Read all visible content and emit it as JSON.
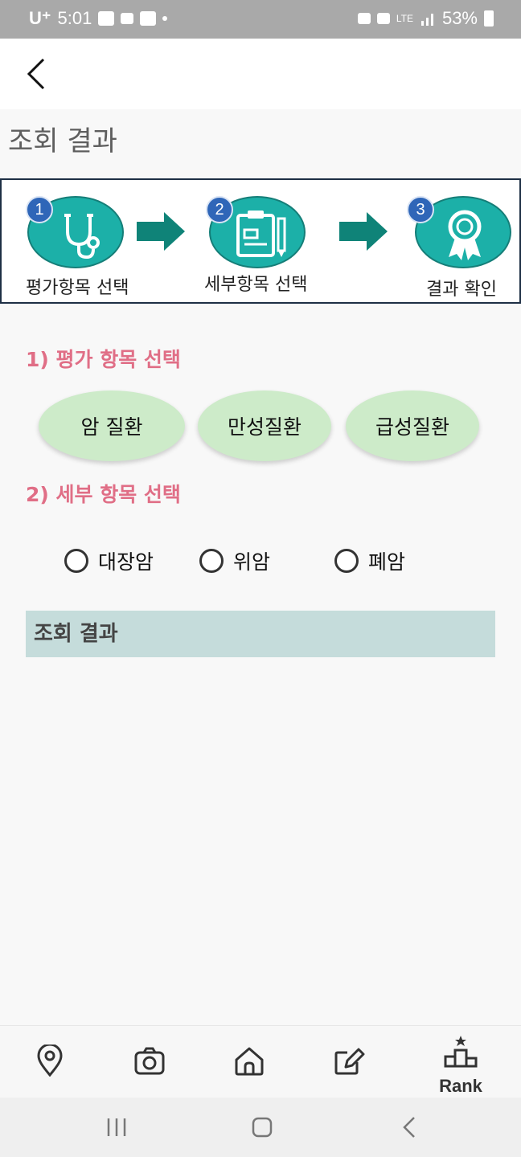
{
  "status_bar": {
    "carrier": "U⁺",
    "time": "5:01",
    "network": "LTE",
    "battery": "53%"
  },
  "header": {
    "page_title": "조회 결과"
  },
  "steps": [
    {
      "number": "1",
      "label": "평가항목 선택",
      "icon": "stethoscope-icon"
    },
    {
      "number": "2",
      "label": "세부항목 선택",
      "icon": "clipboard-icon"
    },
    {
      "number": "3",
      "label": "결과 확인",
      "icon": "award-ribbon-icon"
    }
  ],
  "section1": {
    "label": "1) 평가 항목 선택",
    "buttons": [
      "암 질환",
      "만성질환",
      "급성질환"
    ]
  },
  "section2": {
    "label": "2) 세부 항목 선택",
    "options": [
      "대장암",
      "위암",
      "폐암"
    ]
  },
  "result": {
    "label": "조회 결과"
  },
  "bottom_nav": {
    "items": [
      "location-pin-icon",
      "camera-icon",
      "home-icon",
      "edit-icon",
      "rank-icon"
    ],
    "rank_label": "Rank"
  },
  "colors": {
    "teal": "#1cb0a8",
    "pink": "#e06e86",
    "mint": "#cdebc9",
    "result_bg": "#c5dcdb",
    "step_number": "#2f66b8"
  }
}
